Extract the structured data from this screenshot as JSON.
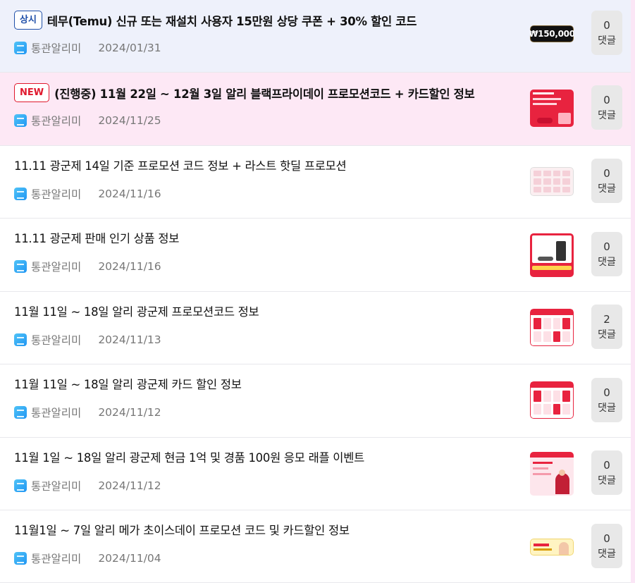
{
  "posts": [
    {
      "badge": "상시",
      "badge_type": "sang",
      "title": "테무(Temu) 신규 또는 재설치 사용자 15만원 상당 쿠폰 + 30% 할인 코드",
      "category": "통관알리미",
      "date": "2024/01/31",
      "comment_count": "0",
      "comment_label": "댓글",
      "thumb_text": "₩150,000",
      "thumb_style": "temu"
    },
    {
      "badge": "NEW",
      "badge_type": "new",
      "title": "(진행중) 11월 22일 ~ 12월 3일 알리 블랙프라이데이 프로모션코드 + 카드할인 정보",
      "category": "통관알리미",
      "date": "2024/11/25",
      "comment_count": "0",
      "comment_label": "댓글",
      "thumb_style": "blackfriday"
    },
    {
      "badge": "",
      "badge_type": "",
      "title": "11.11 광군제 14일 기준 프로모션 코드 정보 + 라스트 핫딜 프로모션",
      "category": "통관알리미",
      "date": "2024/11/16",
      "comment_count": "0",
      "comment_label": "댓글",
      "thumb_style": "grid"
    },
    {
      "badge": "",
      "badge_type": "",
      "title": "11.11 광군제 판매 인기 상품 정보",
      "category": "통관알리미",
      "date": "2024/11/16",
      "comment_count": "0",
      "comment_label": "댓글",
      "thumb_style": "vacuum"
    },
    {
      "badge": "",
      "badge_type": "",
      "title": "11월 11일 ~ 18일 알리 광군제 프로모션코드 정보",
      "category": "통관알리미",
      "date": "2024/11/13",
      "comment_count": "2",
      "comment_label": "댓글",
      "thumb_style": "calendar"
    },
    {
      "badge": "",
      "badge_type": "",
      "title": "11월 11일 ~ 18일 알리 광군제 카드 할인 정보",
      "category": "통관알리미",
      "date": "2024/11/12",
      "comment_count": "0",
      "comment_label": "댓글",
      "thumb_style": "calendar"
    },
    {
      "badge": "",
      "badge_type": "",
      "title": "11월 1일 ~ 18일 알리 광군제 현금 1억 및 경품 100원 응모 래플 이벤트",
      "category": "통관알리미",
      "date": "2024/11/12",
      "comment_count": "0",
      "comment_label": "댓글",
      "thumb_style": "raffle"
    },
    {
      "badge": "",
      "badge_type": "",
      "title": "11월1일 ~ 7일 알리 메가 초이스데이 프로모션 코드 및 카드할인 정보",
      "category": "통관알리미",
      "date": "2024/11/04",
      "comment_count": "0",
      "comment_label": "댓글",
      "thumb_style": "choiceday"
    }
  ]
}
